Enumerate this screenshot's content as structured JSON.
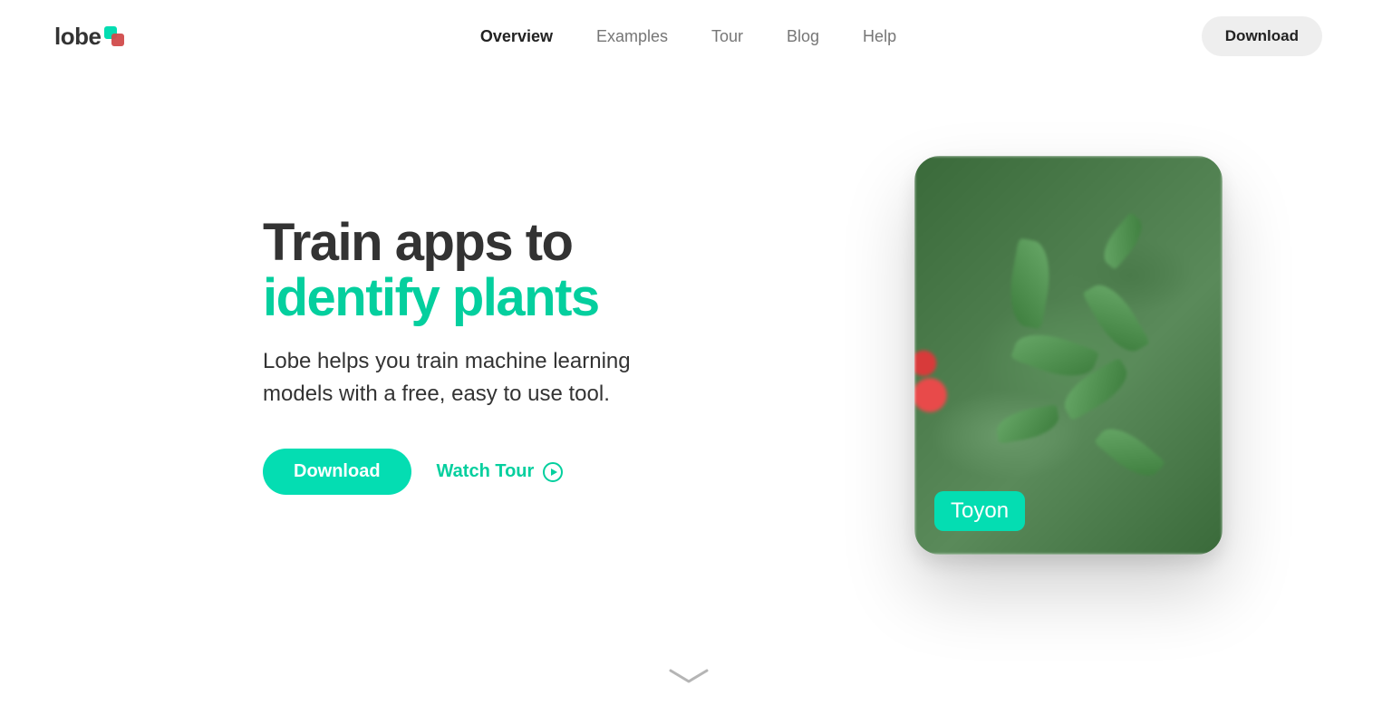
{
  "brand": {
    "name": "lobe"
  },
  "nav": {
    "items": [
      {
        "label": "Overview",
        "active": true
      },
      {
        "label": "Examples",
        "active": false
      },
      {
        "label": "Tour",
        "active": false
      },
      {
        "label": "Blog",
        "active": false
      },
      {
        "label": "Help",
        "active": false
      }
    ],
    "download_label": "Download"
  },
  "hero": {
    "title_line1": "Train apps to",
    "title_line2": "identify plants",
    "subtitle": "Lobe helps you train machine learning models with a free, easy to use tool.",
    "primary_cta": "Download",
    "secondary_cta": "Watch Tour",
    "card_tag": "Toyon"
  },
  "colors": {
    "accent": "#04cf9e",
    "accent_bright": "#04ddb2"
  }
}
